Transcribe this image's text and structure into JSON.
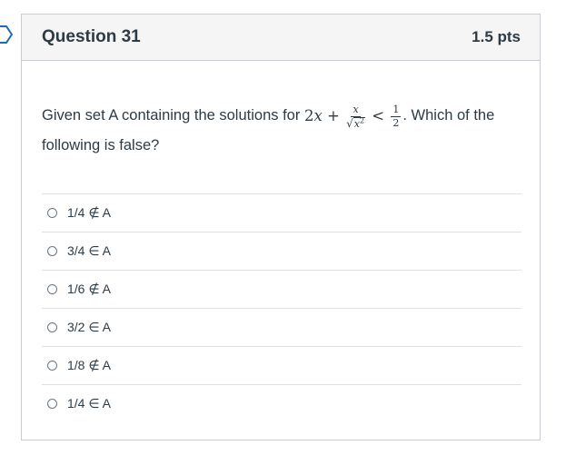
{
  "question": {
    "title": "Question 31",
    "points": "1.5 pts",
    "text_before": "Given set A containing the solutions for",
    "text_after": ". Which of the following is false?",
    "equation": {
      "lhs_coef": "2",
      "lhs_var": "x",
      "plus": "+",
      "frac_num": "x",
      "frac_den_var": "x",
      "frac_den_exp": "2",
      "relation": "<",
      "rhs_num": "1",
      "rhs_den": "2"
    }
  },
  "answers": [
    {
      "label": "1/4 ∉ A",
      "selected": false
    },
    {
      "label": "3/4 ∈ A",
      "selected": false
    },
    {
      "label": "1/6 ∉ A",
      "selected": false
    },
    {
      "label": "3/2 ∈ A",
      "selected": false
    },
    {
      "label": "1/8 ∉ A",
      "selected": false
    },
    {
      "label": "1/4 ∈ A",
      "selected": false
    }
  ],
  "colors": {
    "text": "#2d3b45",
    "border": "#c7cdd1",
    "header_bg": "#f5f5f5",
    "divider": "#dfe2e4",
    "flag": "#1b6bb5"
  }
}
